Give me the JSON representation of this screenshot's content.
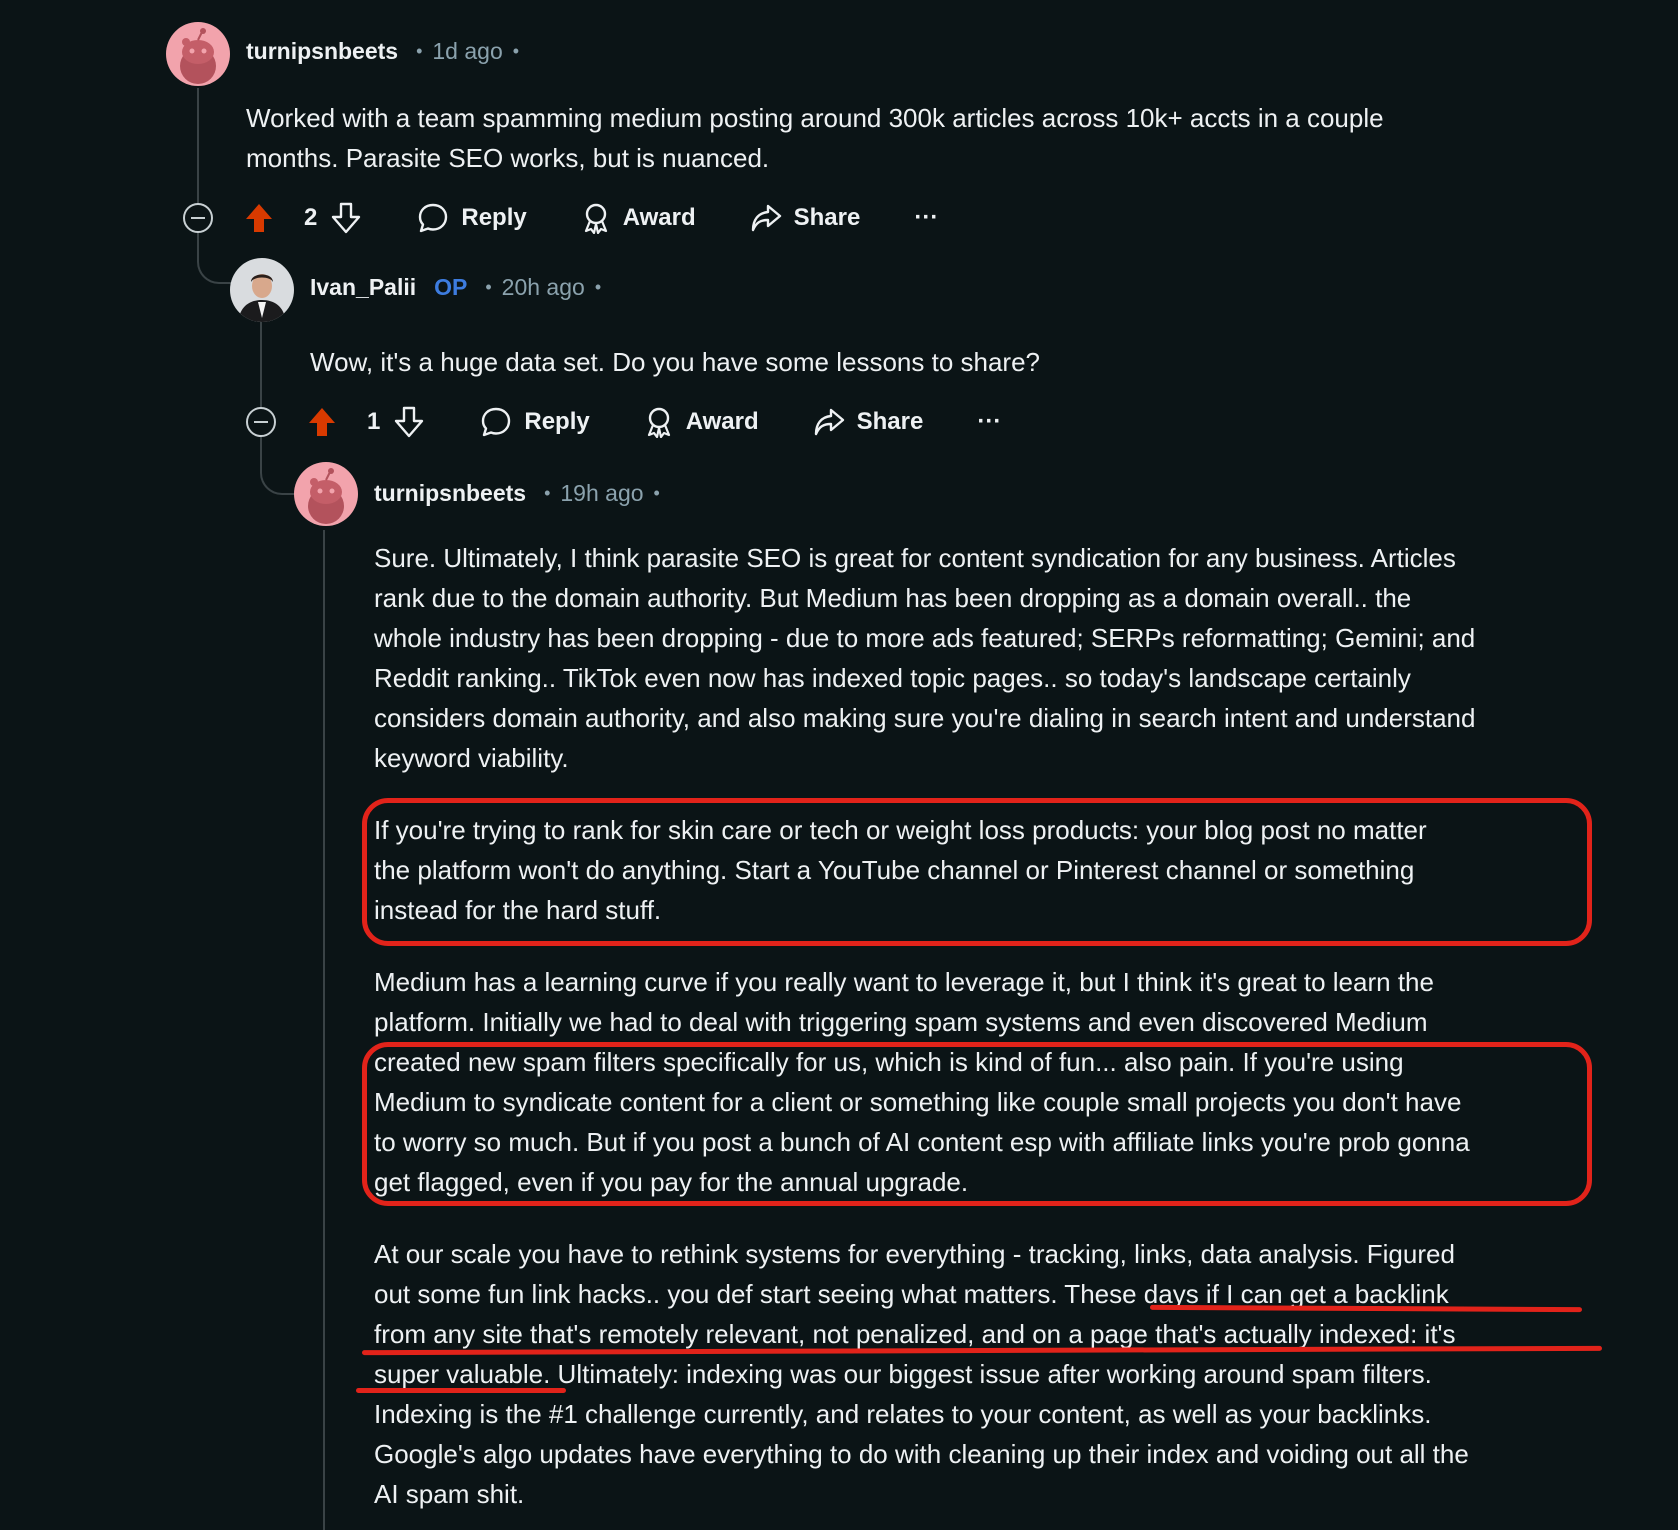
{
  "comment1": {
    "username": "turnipsnbeets",
    "time": "1d ago",
    "text_line1": "Worked with a team spamming medium posting around 300k articles across 10k+ accts in a couple",
    "text_line2": "months. Parasite SEO works, but is nuanced.",
    "votes": "2",
    "reply_label": "Reply",
    "award_label": "Award",
    "share_label": "Share",
    "more_label": "···"
  },
  "comment2": {
    "username": "Ivan_Palii",
    "op_badge": "OP",
    "time": "20h ago",
    "text": "Wow, it's a huge data set. Do you have some lessons to share?",
    "votes": "1",
    "reply_label": "Reply",
    "award_label": "Award",
    "share_label": "Share",
    "more_label": "···"
  },
  "comment3": {
    "username": "turnipsnbeets",
    "time": "19h ago",
    "para1": [
      "Sure. Ultimately, I think parasite SEO is great for content syndication for any business. Articles",
      "rank due to the domain authority. But Medium has been dropping as a domain overall.. the",
      "whole industry has been dropping - due to more ads featured; SERPs reformatting; Gemini; and",
      "Reddit ranking.. TikTok even now has indexed topic pages.. so today's landscape certainly",
      "considers domain authority, and also making sure you're dialing in search intent and understand",
      "keyword viability."
    ],
    "para2": [
      "If you're trying to rank for skin care or tech or weight loss products: your blog post no matter",
      "the platform won't do anything. Start a YouTube channel or Pinterest channel or something",
      "instead for the hard stuff."
    ],
    "para3": [
      "Medium has a learning curve if you really want to leverage it, but I think it's great to learn the",
      "platform. Initially we had to deal with triggering spam systems and even discovered Medium",
      "created new spam filters specifically for us, which is kind of fun... also pain. If you're using",
      "Medium to syndicate content for a client or something like couple small projects you don't have",
      "to worry so much. But if you post a bunch of AI content esp with affiliate links you're prob gonna",
      "get flagged, even if you pay for the annual upgrade."
    ],
    "para4": [
      "At our scale you have to rethink systems for everything - tracking, links, data analysis. Figured",
      "out some fun link hacks.. you def start seeing what matters. These days if I can get a backlink",
      "from any site that's remotely relevant, not penalized, and on a page that's actually indexed: it's",
      "super valuable. Ultimately: indexing was our biggest issue after working around spam filters.",
      "Indexing is the #1 challenge currently, and relates to your content, as well as your backlinks.",
      "Google's algo updates have everything to do with cleaning up their index and voiding out all the",
      "AI spam shit."
    ]
  },
  "colors": {
    "background": "#0b1416",
    "upvote": "#d93a00",
    "op": "#3d7cdf",
    "highlight": "#e2231a"
  }
}
